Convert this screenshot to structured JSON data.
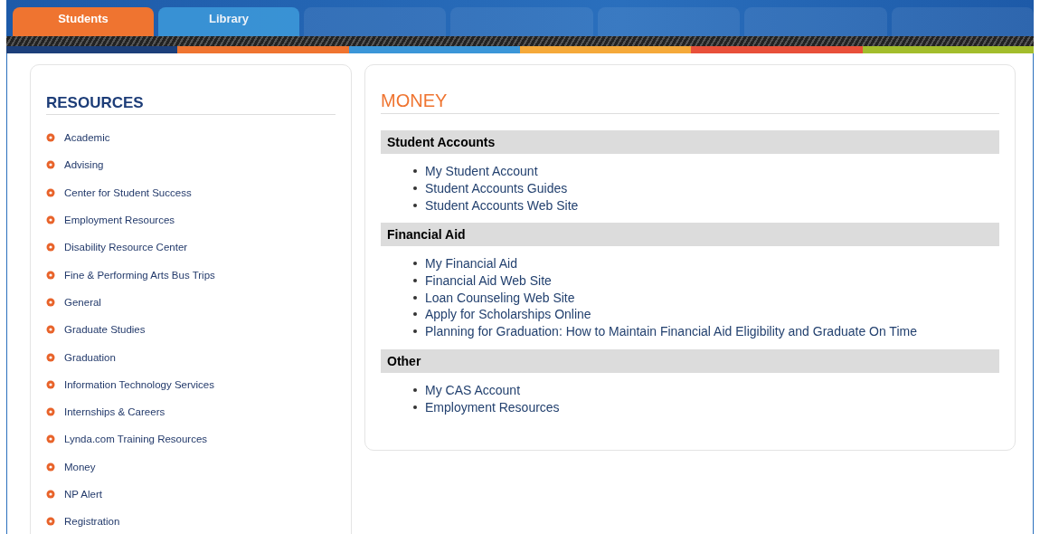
{
  "tabs": [
    {
      "label": "Students",
      "color": "#ef7430",
      "selected": true
    },
    {
      "label": "Library",
      "color": "#3b96d8",
      "selected": false
    }
  ],
  "sidebar": {
    "title": "RESOURCES",
    "items": [
      "Academic",
      "Advising",
      "Center for Student Success",
      "Employment Resources",
      "Disability Resource Center",
      "Fine & Performing Arts Bus Trips",
      "General",
      "Graduate Studies",
      "Graduation",
      "Information Technology Services",
      "Internships & Careers",
      "Lynda.com Training Resources",
      "Money",
      "NP Alert",
      "Registration"
    ]
  },
  "main": {
    "title": "MONEY",
    "sections": [
      {
        "heading": "Student Accounts",
        "links": [
          "My Student Account",
          "Student Accounts Guides",
          "Student Accounts Web Site"
        ]
      },
      {
        "heading": "Financial Aid",
        "links": [
          "My Financial Aid",
          "Financial Aid Web Site",
          "Loan Counseling Web Site",
          "Apply for Scholarships Online",
          "Planning for Graduation: How to Maintain Financial Aid Eligibility and Graduate On Time"
        ]
      },
      {
        "heading": "Other",
        "links": [
          "My CAS Account",
          "Employment Resources"
        ]
      }
    ]
  }
}
